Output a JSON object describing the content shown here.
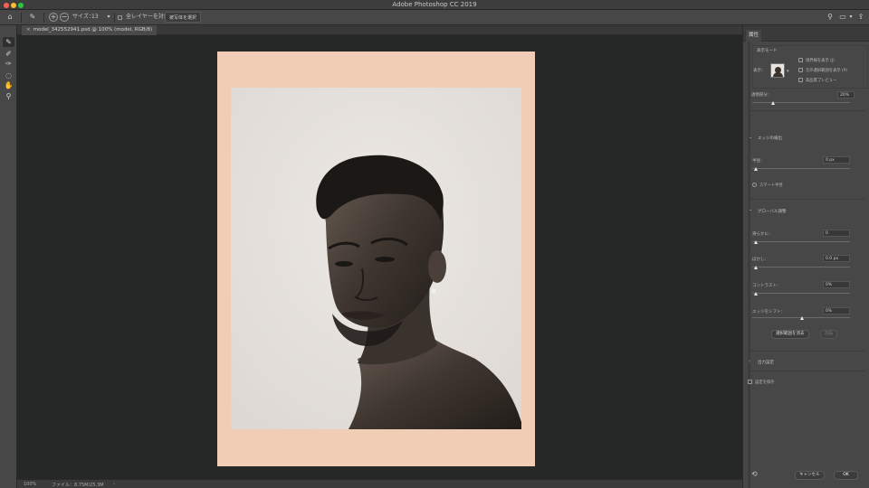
{
  "window": {
    "title": "Adobe Photoshop CC 2019"
  },
  "traffic_lights": [
    "#ff5f57",
    "#febc2e",
    "#28c840"
  ],
  "options_bar": {
    "size_label": "サイズ：",
    "size_value": "13",
    "sample_all_layers": "全レイヤーを対象",
    "select_subject": "被写体を選択"
  },
  "toolbar": {
    "tools": [
      {
        "icon": "quick-selection-brush-icon",
        "glyph": "✎",
        "active": true
      },
      {
        "icon": "refine-edge-brush-icon",
        "glyph": "✐",
        "active": false
      },
      {
        "icon": "brush-icon",
        "glyph": "✑",
        "active": false
      },
      {
        "icon": "lasso-icon",
        "glyph": "◌",
        "active": false
      },
      {
        "icon": "hand-icon",
        "glyph": "✋",
        "active": false
      },
      {
        "icon": "zoom-icon",
        "glyph": "⚲",
        "active": false
      }
    ]
  },
  "document": {
    "tab_label": "model_342552941.psd @ 100% (model, RGB/8)"
  },
  "status": {
    "zoom": "100%",
    "file_info": "ファイル：8.75M/25.3M",
    "arrow": "›"
  },
  "panel": {
    "tab": "属性",
    "view_mode": {
      "title": "表示モード",
      "view_label": "表示：",
      "options": [
        "境界線を表示 (J)",
        "元の選択範囲を表示 (P)",
        "高品質プレビュー"
      ]
    },
    "opacity": {
      "label": "透明部分：",
      "value": "20%"
    },
    "edge_detection": {
      "title": "エッジの検出",
      "radius_label": "半径：",
      "radius_value": "0 px",
      "smart_radius": "スマート半径"
    },
    "global_refinements": {
      "title": "グローバル調整",
      "smooth_label": "滑らかに：",
      "smooth_value": "0",
      "feather_label": "ぼかし：",
      "feather_value": "0.0 px",
      "contrast_label": "コントラスト：",
      "contrast_value": "0%",
      "shift_label": "エッジをシフト：",
      "shift_value": "0%",
      "clear_button": "選択範囲を消去",
      "invert_button": "反転"
    },
    "output": {
      "title": "出力設定"
    },
    "remember": "設定を保存",
    "cancel": "キャンセル",
    "ok": "OK"
  }
}
